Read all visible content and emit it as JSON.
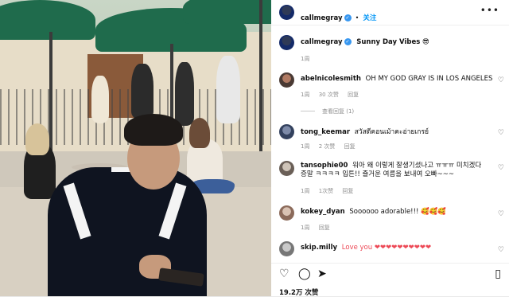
{
  "header": {
    "username": "callmegray",
    "separator": "•",
    "follow_label": "关注",
    "more_label": "•••"
  },
  "caption": {
    "username": "callmegray",
    "text": "Sunny Day Vibes",
    "emoji": "😎",
    "time": "1周"
  },
  "comments": [
    {
      "username": "abelnicolesmith",
      "text": "OH MY GOD GRAY IS IN LOS ANGELES",
      "time": "1周",
      "likes": "30 次赞",
      "reply": "回复",
      "view_replies": "查看回复 (1)"
    },
    {
      "username": "tong_keemar",
      "text": "สวัสดีคอนเม้าคะอ่ายเกรย์",
      "time": "1周",
      "likes": "2 次赞",
      "reply": "回复"
    },
    {
      "username": "tansophie00",
      "text": "워아 왜 이렇게 잘생기셨나고 ㅠㅠㅠ 미치겠다 증말 ㅋㅋㅋㅋ 입튼!! 즐거운 여름을 보내여 오빠~~~",
      "time": "1周",
      "likes": "1次赞",
      "reply": "回复"
    },
    {
      "username": "kokey_dyan",
      "text": "Soooooo adorable!!! 🥰🥰🥰",
      "time": "1周",
      "reply": "回复"
    },
    {
      "username": "skip.milly",
      "text": "Love you ❤❤❤❤❤❤❤❤❤❤"
    }
  ],
  "actions": {
    "like_icon": "heart-icon",
    "comment_icon": "comment-icon",
    "share_icon": "share-icon",
    "save_icon": "bookmark-icon"
  },
  "likes_count": "19.2万 次赞",
  "colors": {
    "link": "#0095f6",
    "verified": "#3897f0",
    "heart": "#ed4956"
  }
}
